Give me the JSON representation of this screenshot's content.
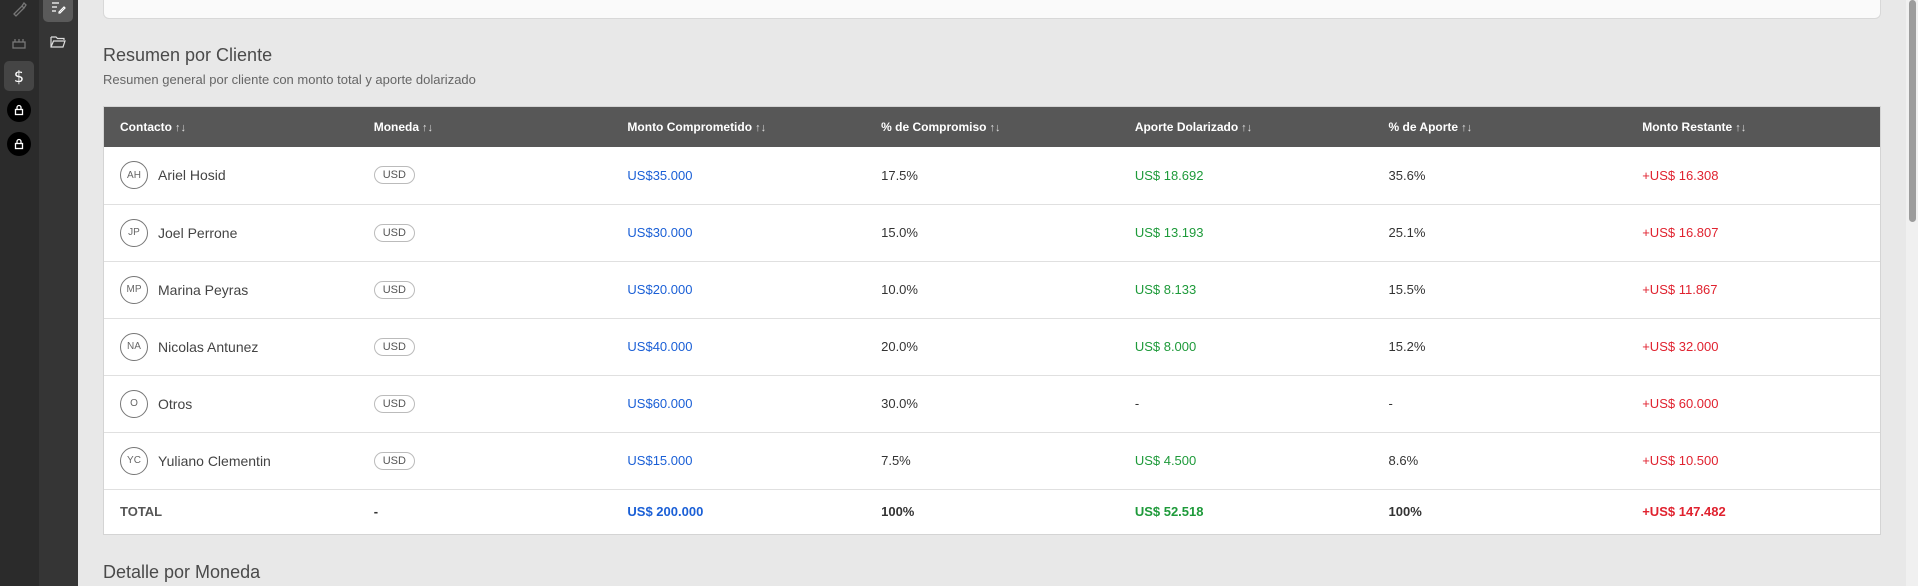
{
  "summary": {
    "title": "Resumen por Cliente",
    "subtitle": "Resumen general por cliente con monto total y aporte dolarizado"
  },
  "next_section": {
    "title": "Detalle por Moneda"
  },
  "table": {
    "columns": [
      "Contacto",
      "Moneda",
      "Monto Comprometido",
      "% de Compromiso",
      "Aporte Dolarizado",
      "% de Aporte",
      "Monto Restante"
    ],
    "sort_glyph": "↑↓",
    "rows": [
      {
        "initials": "AH",
        "name": "Ariel Hosid",
        "currency": "USD",
        "committed": "US$35.000",
        "commit_pct": "17.5%",
        "contribution": "US$ 18.692",
        "contrib_pct": "35.6%",
        "remaining": "+US$ 16.308"
      },
      {
        "initials": "JP",
        "name": "Joel Perrone",
        "currency": "USD",
        "committed": "US$30.000",
        "commit_pct": "15.0%",
        "contribution": "US$ 13.193",
        "contrib_pct": "25.1%",
        "remaining": "+US$ 16.807"
      },
      {
        "initials": "MP",
        "name": "Marina Peyras",
        "currency": "USD",
        "committed": "US$20.000",
        "commit_pct": "10.0%",
        "contribution": "US$ 8.133",
        "contrib_pct": "15.5%",
        "remaining": "+US$ 11.867"
      },
      {
        "initials": "NA",
        "name": "Nicolas Antunez",
        "currency": "USD",
        "committed": "US$40.000",
        "commit_pct": "20.0%",
        "contribution": "US$ 8.000",
        "contrib_pct": "15.2%",
        "remaining": "+US$ 32.000"
      },
      {
        "initials": "O",
        "name": "Otros",
        "currency": "USD",
        "committed": "US$60.000",
        "commit_pct": "30.0%",
        "contribution": "-",
        "contrib_pct": "-",
        "remaining": "+US$ 60.000"
      },
      {
        "initials": "YC",
        "name": "Yuliano Clementin",
        "currency": "USD",
        "committed": "US$15.000",
        "commit_pct": "7.5%",
        "contribution": "US$ 4.500",
        "contrib_pct": "8.6%",
        "remaining": "+US$ 10.500"
      }
    ],
    "total": {
      "label": "TOTAL",
      "currency": "-",
      "committed": "US$ 200.000",
      "commit_pct": "100%",
      "contribution": "US$ 52.518",
      "contrib_pct": "100%",
      "remaining": "+US$ 147.482"
    }
  },
  "sidebar": {
    "icons": [
      "brush-icon",
      "cake-icon",
      "dollar-icon",
      "lock-icon",
      "lock-icon"
    ],
    "sub_icons": [
      "edit-list-icon",
      "folder-open-icon"
    ]
  },
  "colors": {
    "header_bg": "#575757",
    "amount_blue": "#1a5fd6",
    "contribution_green": "#1e9a3a",
    "remaining_red": "#e0222f"
  }
}
